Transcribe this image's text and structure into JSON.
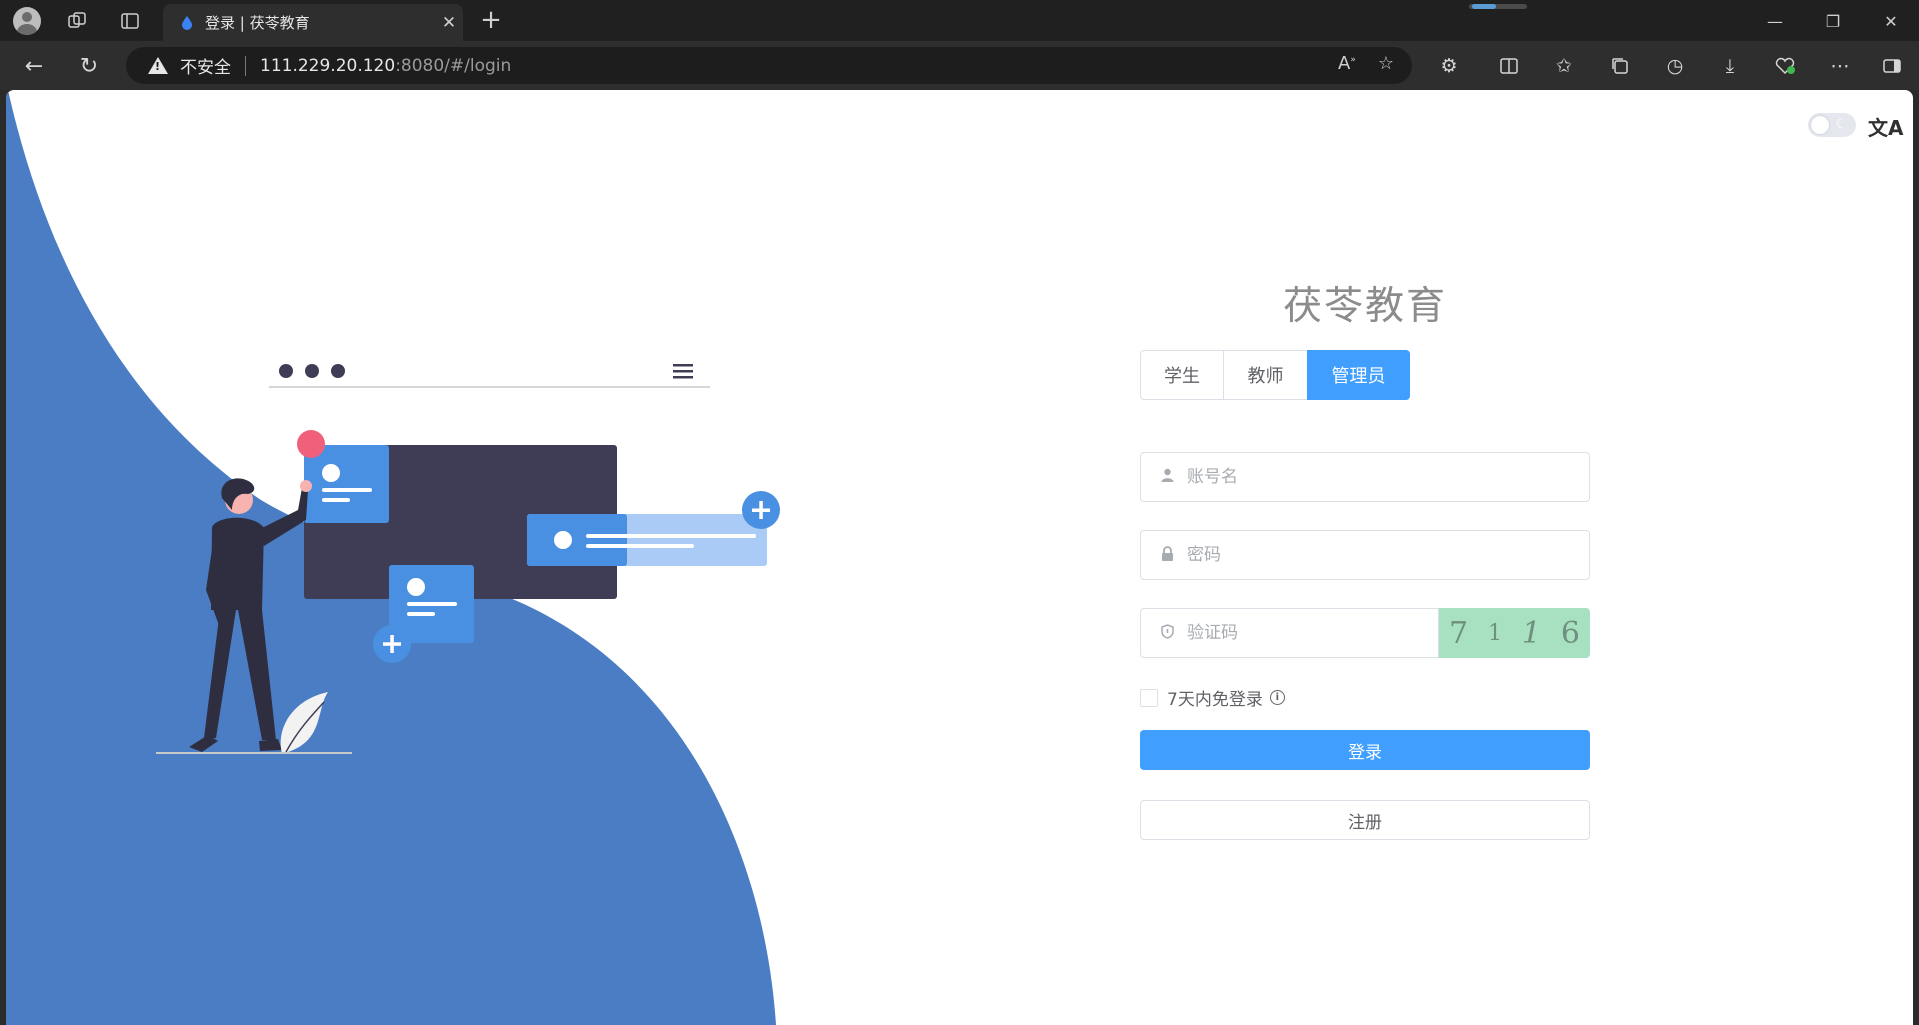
{
  "browser": {
    "tab_title": "登录 | 茯苓教育",
    "address": {
      "security_label": "不安全",
      "host": "111.229.20.120",
      "rest": ":8080/#/login"
    }
  },
  "page": {
    "brand_title": "茯苓教育",
    "roles": [
      {
        "label": "学生",
        "active": false
      },
      {
        "label": "教师",
        "active": false
      },
      {
        "label": "管理员",
        "active": true
      }
    ],
    "username": {
      "placeholder": "账号名",
      "value": ""
    },
    "password": {
      "placeholder": "密码",
      "value": ""
    },
    "captcha": {
      "placeholder": "验证码",
      "value": "",
      "image_chars": [
        "7",
        "1",
        "1",
        "6"
      ]
    },
    "remember_label": "7天内免登录",
    "login_label": "登录",
    "register_label": "注册",
    "colors": {
      "primary": "#409eff",
      "wave": "#4a7dc4",
      "captcha_bg": "#a8e0c2"
    }
  }
}
